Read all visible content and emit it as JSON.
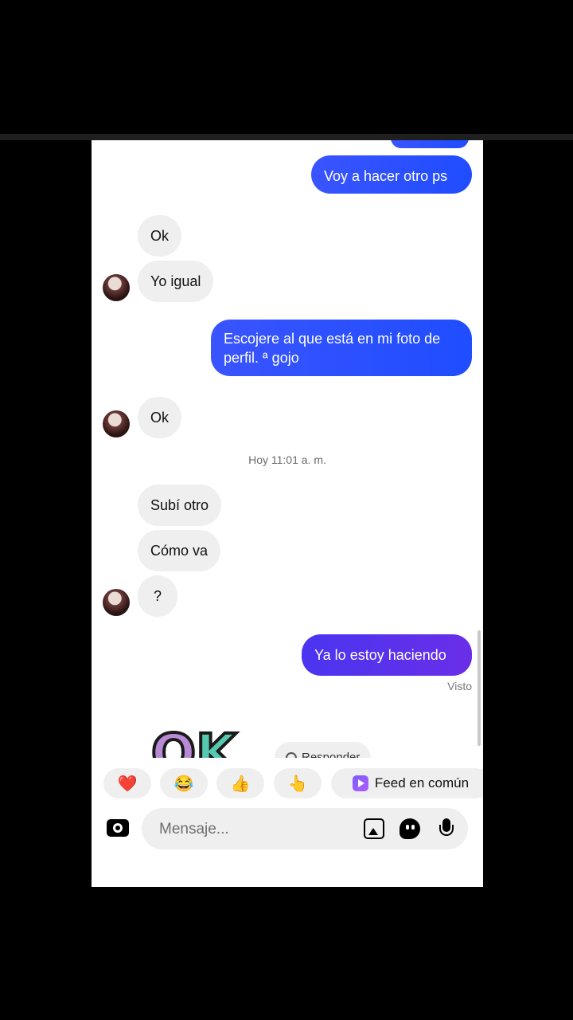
{
  "messages": [
    {
      "id": "m1",
      "dir": "out",
      "text": "Voy a hacer otro ps"
    },
    {
      "id": "m2",
      "dir": "in",
      "text": "Ok"
    },
    {
      "id": "m3",
      "dir": "in",
      "text": "Yo igual"
    },
    {
      "id": "m4",
      "dir": "out",
      "text": "Escojere al que está en mi foto de perfil. ª gojo"
    },
    {
      "id": "m5",
      "dir": "in",
      "text": "Ok"
    },
    {
      "id": "m6",
      "dir": "in",
      "text": "Subí otro"
    },
    {
      "id": "m7",
      "dir": "in",
      "text": "Cómo va"
    },
    {
      "id": "m8",
      "dir": "in",
      "text": "?"
    },
    {
      "id": "m9",
      "dir": "out",
      "text": "Ya lo estoy haciendo"
    }
  ],
  "timestamp": "Hoy 11:01 a. m.",
  "seen_label": "Visto",
  "sticker_text": "OK",
  "reply_chip_label": "Responder",
  "quick_reactions": [
    {
      "icon": "heart-icon",
      "glyph": "❤️"
    },
    {
      "icon": "laughing-emoji-icon",
      "glyph": "😂"
    },
    {
      "icon": "thumbs-up-icon",
      "glyph": "👍"
    },
    {
      "icon": "pointing-hand-icon",
      "glyph": "👆"
    }
  ],
  "feed_chip_label": "Feed en común",
  "composer": {
    "placeholder": "Mensaje..."
  }
}
